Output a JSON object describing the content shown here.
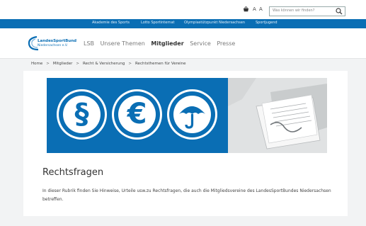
{
  "utility": {
    "font_size_label": "A A",
    "search_placeholder": "Was können wir finden?"
  },
  "topnav": {
    "items": [
      "Akademie des Sports",
      "Lotto Sportinternat",
      "Olympiastützpunkt Niedersachsen",
      "Sportjugend"
    ]
  },
  "logo": {
    "line1": "LandesSportBund",
    "line2": "Niedersachsen e.V."
  },
  "mainnav": {
    "items": [
      "LSB",
      "Unsere Themen",
      "Mitglieder",
      "Service",
      "Presse"
    ],
    "active": "Mitglieder"
  },
  "breadcrumb": [
    "Home",
    "Mitglieder",
    "Recht & Versicherung",
    "Rechtsthemen für Vereine"
  ],
  "hero": {
    "symbols": [
      "§",
      "€"
    ],
    "icons": [
      "paragraph-icon",
      "euro-icon",
      "umbrella-icon"
    ]
  },
  "content": {
    "title": "Rechtsfragen",
    "description": "In dieser Rubrik finden Sie Hinweise, Urteile usw.zu Rechtsfragen, die auch die Mitgliedsvereine des LandesSportBundes Niedersachsen betreffen."
  },
  "colors": {
    "brand_blue": "#0a6eb4",
    "background": "#f2f3f4"
  }
}
